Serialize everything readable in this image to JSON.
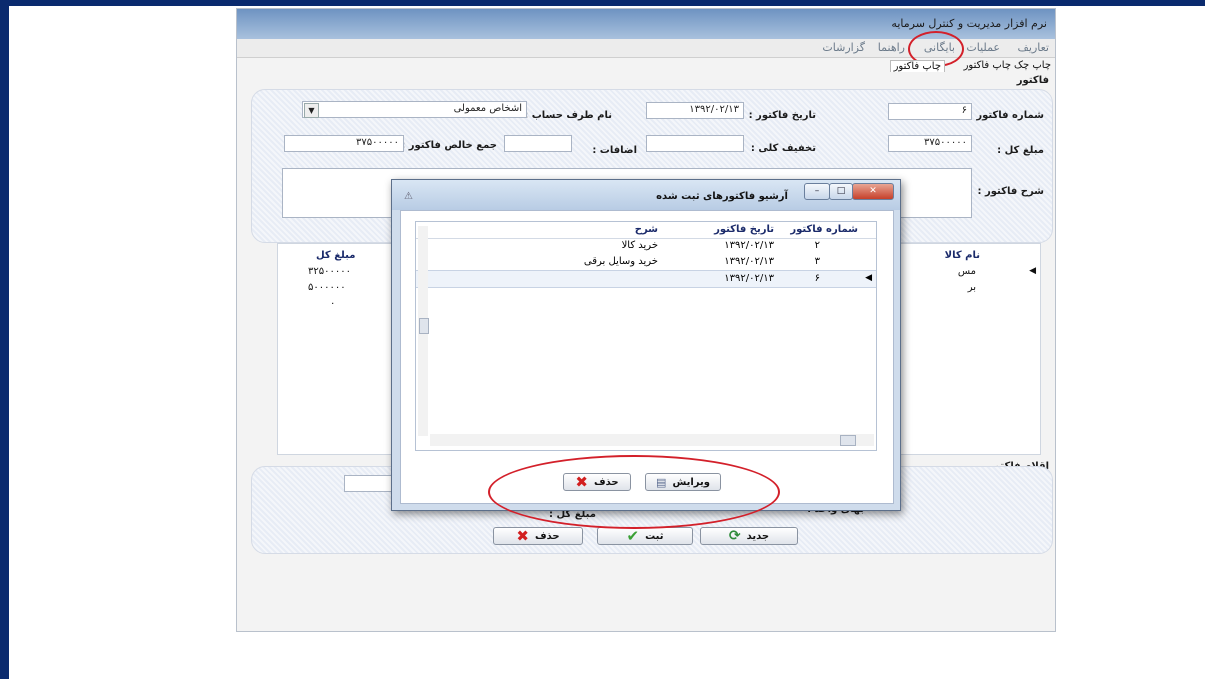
{
  "window": {
    "title": "نرم افزار مدیریت و کنترل سرمایه"
  },
  "menu": [
    "تعاریف",
    "عملیات",
    "بایگانی",
    "راهنما",
    "گزارشات"
  ],
  "subtabs": [
    "چاپ چک",
    "چاپ فاکتور",
    "چاپ فاکتور"
  ],
  "section_title": "فاکتور",
  "form": {
    "invoice_no_label": "شماره فاکتور :",
    "invoice_no": "۶",
    "invoice_date_label": "تاریخ فاکتور :",
    "invoice_date": "۱۳۹۲/۰۲/۱۳",
    "account_label": "نام طرف حساب :",
    "account_value": "اشخاص معمولی",
    "total_label": "مبلغ کل :",
    "total_value": "۳۷۵۰۰۰۰۰",
    "discount_label": "تخفیف کلی :",
    "additions_label": "اضافات :",
    "net_label": "جمع خالص فاکتور :",
    "net_value": "۳۷۵۰۰۰۰۰",
    "description_label": "شرح فاکتور :"
  },
  "main_grid": {
    "headers": [
      "نام کالا",
      "مبلغ کل"
    ],
    "amounts": [
      "۳۲۵۰۰۰۰۰",
      "۵۰۰۰۰۰۰",
      "۰"
    ],
    "names": [
      "مس",
      "بر"
    ]
  },
  "items_section": {
    "title": "اقلام فاکتور",
    "unit_price_label": "بهای واحد :",
    "total_label": "مبلغ کل :"
  },
  "bottom_buttons": {
    "save": "ثبت",
    "delete": "حذف",
    "new": "جدید"
  },
  "dialog": {
    "title": "آرشیو فاکتورهای ثبت شده",
    "columns": [
      "شماره فاکتور",
      "تاریخ فاکتور",
      "شرح"
    ],
    "rows": [
      {
        "no": "۲",
        "date": "۱۳۹۲/۰۲/۱۳",
        "desc": "خرید کالا"
      },
      {
        "no": "۳",
        "date": "۱۳۹۲/۰۲/۱۳",
        "desc": "خرید وسایل برقی"
      },
      {
        "no": "۶",
        "date": "۱۳۹۲/۰۲/۱۳",
        "desc": ""
      }
    ],
    "edit_label": "ویرایش",
    "delete_label": "حذف"
  },
  "colors": {
    "highlight": "#d3202a",
    "accent_blue": "#1a2a6a"
  }
}
